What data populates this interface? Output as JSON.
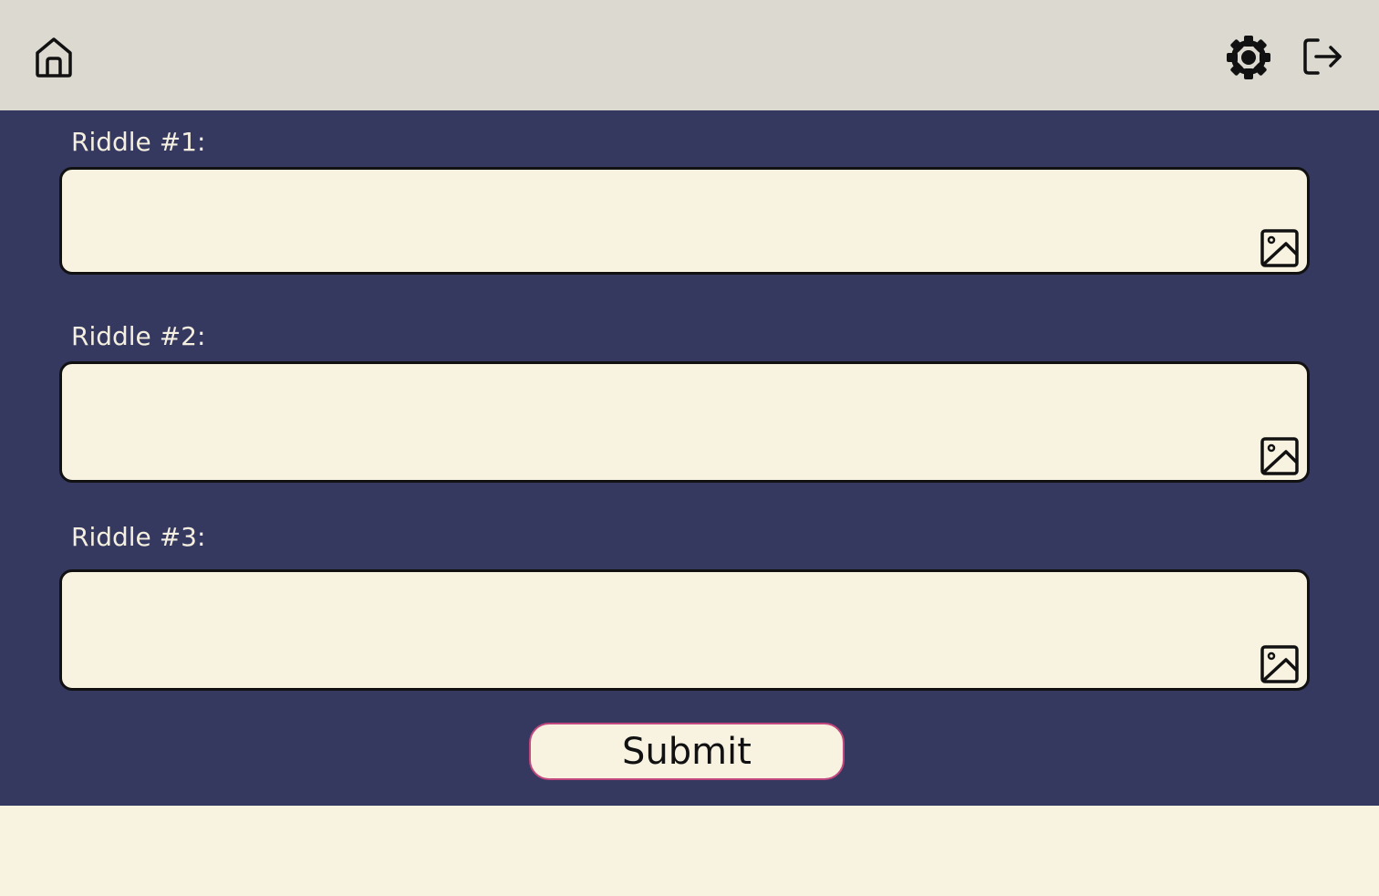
{
  "header": {
    "home_icon": "home-icon",
    "settings_icon": "gear-icon",
    "logout_icon": "logout-icon"
  },
  "riddles": [
    {
      "label": "Riddle #1:",
      "value": "",
      "image_icon": "image-icon"
    },
    {
      "label": "Riddle #2:",
      "value": "",
      "image_icon": "image-icon"
    },
    {
      "label": "Riddle #3:",
      "value": "",
      "image_icon": "image-icon"
    }
  ],
  "submit_label": "Submit",
  "colors": {
    "header_bg": "#dcdad0",
    "main_bg": "#353960",
    "field_bg": "#f8f2e1",
    "submit_border": "#c2477e"
  }
}
